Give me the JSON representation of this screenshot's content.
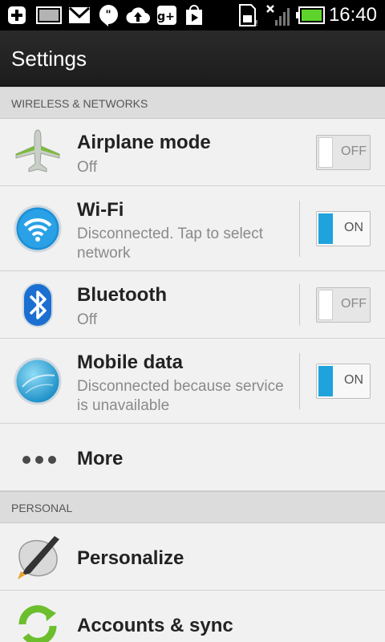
{
  "status_bar": {
    "time": "16:40",
    "icons": [
      "add-icon",
      "keyboard-icon",
      "gmail-icon",
      "hangouts-icon",
      "upload-icon",
      "google-plus-icon",
      "play-store-icon",
      "sim-icon",
      "no-signal-icon",
      "battery-icon"
    ]
  },
  "header": {
    "title": "Settings"
  },
  "sections": [
    {
      "title": "WIRELESS & NETWORKS"
    },
    {
      "title": "PERSONAL"
    }
  ],
  "rows": [
    {
      "label": "Airplane mode",
      "subtitle": "Off",
      "toggle": "OFF",
      "icon": "airplane-icon"
    },
    {
      "label": "Wi-Fi",
      "subtitle": "Disconnected. Tap to select network",
      "toggle": "ON",
      "icon": "wifi-icon"
    },
    {
      "label": "Bluetooth",
      "subtitle": "Off",
      "toggle": "OFF",
      "icon": "bluetooth-icon"
    },
    {
      "label": "Mobile data",
      "subtitle": "Disconnected because service is unavailable",
      "toggle": "ON",
      "icon": "mobile-data-globe-icon"
    },
    {
      "label": "More",
      "icon": "more-dots-icon"
    },
    {
      "label": "Personalize",
      "icon": "personalize-brush-icon"
    },
    {
      "label": "Accounts & sync",
      "icon": "sync-icon"
    }
  ],
  "colors": {
    "accent": "#1fa3dd",
    "header_bg": "#1c1c1c",
    "list_bg": "#f1f1f1",
    "section_bg": "#dcdcdc"
  }
}
